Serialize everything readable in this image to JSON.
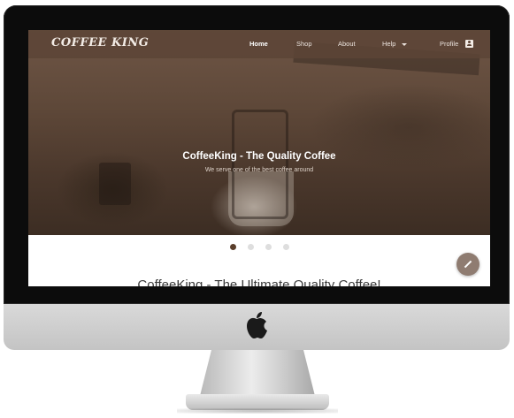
{
  "navbar": {
    "brand": "COFFEE KING",
    "items": [
      {
        "label": "Home"
      },
      {
        "label": "Shop"
      },
      {
        "label": "About"
      },
      {
        "label": "Help"
      },
      {
        "label": "Profile"
      }
    ],
    "active": "Home",
    "icons": {
      "help_dropdown": "caret-down-icon",
      "profile": "account-box-icon"
    }
  },
  "hero": {
    "title": "CoffeeKing - The Quality Coffee",
    "subtitle": "We serve one of the best coffee around"
  },
  "carousel": {
    "slide_count": 4,
    "active_index": 0
  },
  "main": {
    "heading": "CoffeeKing - The Ultimate Quality Coffee!"
  },
  "fab": {
    "icon": "edit-pencil-icon"
  },
  "colors": {
    "navbar": "#5c4436",
    "active_dot": "#5a3e2b",
    "inactive_dot": "#dedede",
    "fab": "#8f7c71"
  }
}
